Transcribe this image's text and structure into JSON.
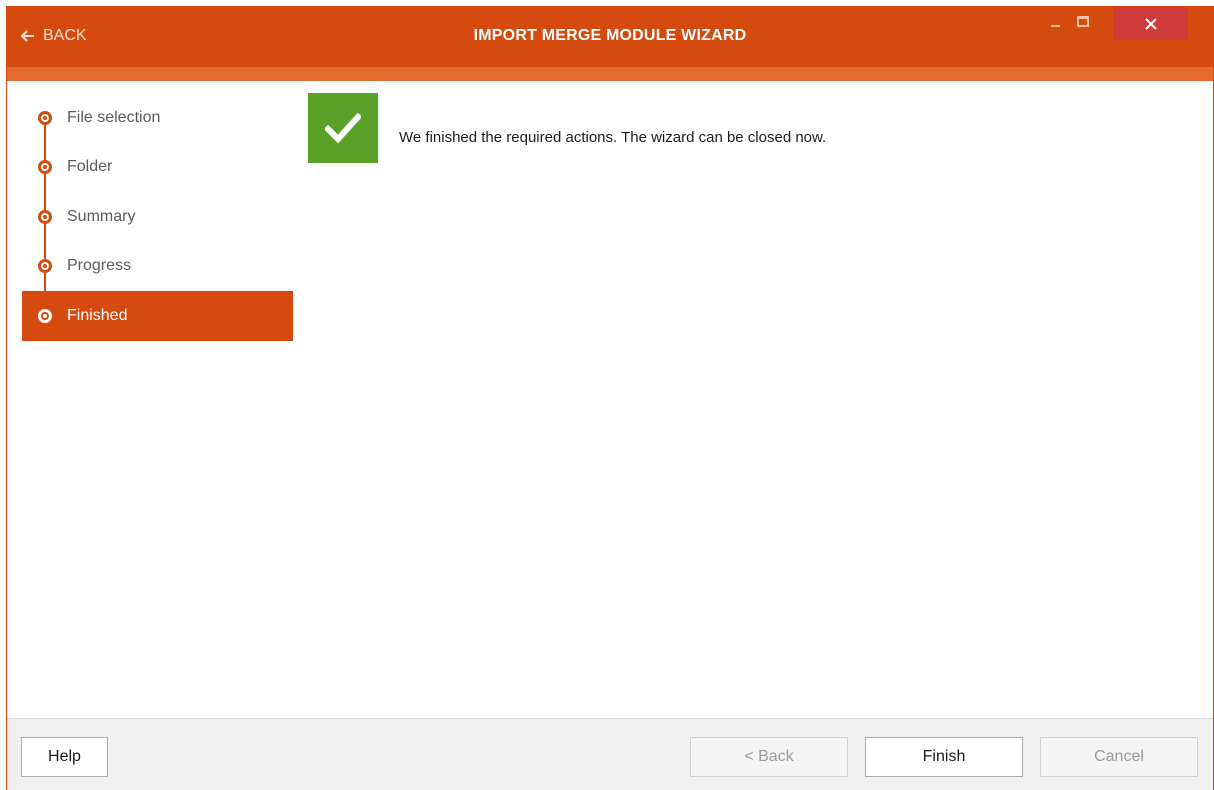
{
  "titlebar": {
    "back_label": "BACK",
    "title": "IMPORT MERGE MODULE WIZARD",
    "accent_color": "#d54a0f",
    "close_color": "#cf3a3a"
  },
  "steps": [
    {
      "label": "File selection",
      "active": false
    },
    {
      "label": "Folder",
      "active": false
    },
    {
      "label": "Summary",
      "active": false
    },
    {
      "label": "Progress",
      "active": false
    },
    {
      "label": "Finished",
      "active": true
    }
  ],
  "content": {
    "icon": "checkmark-icon",
    "message": "We finished the required actions. The wizard can be closed now.",
    "success_color": "#5aa128"
  },
  "footer": {
    "help_label": "Help",
    "back_label": "< Back",
    "finish_label": "Finish",
    "cancel_label": "Cancel"
  }
}
